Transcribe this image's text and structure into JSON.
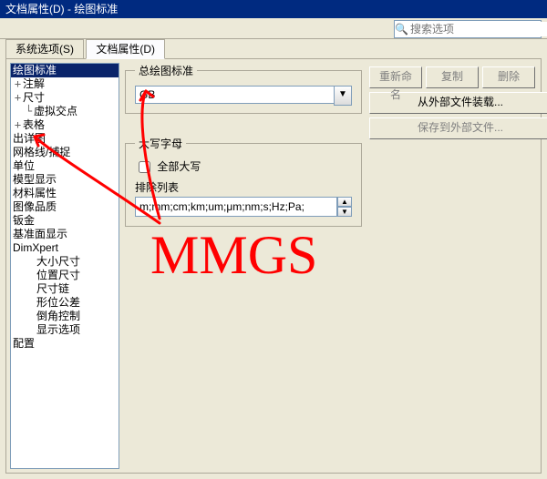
{
  "window": {
    "title": "文档属性(D) - 绘图标准"
  },
  "search": {
    "placeholder": "搜索选项"
  },
  "tabs": {
    "system": "系统选项(S)",
    "doc": "文档属性(D)"
  },
  "tree": {
    "n0": "绘图标准",
    "n1": "注解",
    "n2": "尺寸",
    "n3": "虚拟交点",
    "n4": "表格",
    "n5": "出详图",
    "n6": "网格线/捕捉",
    "n7": "单位",
    "n8": "模型显示",
    "n9": "材料属性",
    "n10": "图像品质",
    "n11": "钣金",
    "n12": "基准面显示",
    "n13": "DimXpert",
    "n14": "大小尺寸",
    "n15": "位置尺寸",
    "n16": "尺寸链",
    "n17": "形位公差",
    "n18": "倒角控制",
    "n19": "显示选项",
    "n20": "配置"
  },
  "std": {
    "legend": "总绘图标准",
    "value": "GB"
  },
  "buttons": {
    "rename": "重新命名",
    "copy": "复制",
    "delete": "删除",
    "load": "从外部文件装载...",
    "save": "保存到外部文件..."
  },
  "upper": {
    "legend": "大写字母",
    "all": "全部大写",
    "exclude_label": "排除列表",
    "exclude_value": "m;mm;cm;km;um;μm;nm;s;Hz;Pa;"
  },
  "handwriting": "MMGS"
}
